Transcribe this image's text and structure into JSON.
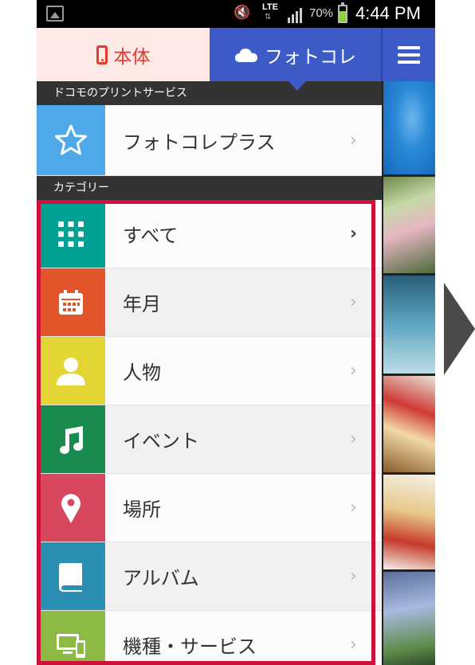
{
  "status_bar": {
    "lte": "LTE",
    "battery_percent": "70%",
    "battery_level": 0.7,
    "time": "4:44 PM"
  },
  "tabs": {
    "device_label": "本体",
    "photocolle_label": "フォトコレ",
    "active": "photocolle",
    "colors": {
      "device_bg": "#fde9e6",
      "device_text": "#e63a2e",
      "photocolle_bg": "#3c5bc6"
    }
  },
  "drawer": {
    "service_header": "ドコモのプリントサービス",
    "service_item": {
      "label": "フォトコレプラス",
      "icon": "star-icon",
      "color": "#4fa8e8"
    },
    "category_header": "カテゴリー",
    "categories": [
      {
        "label": "すべて",
        "icon": "grid-icon",
        "color": "#00a195"
      },
      {
        "label": "年月",
        "icon": "calendar-icon",
        "color": "#e25429"
      },
      {
        "label": "人物",
        "icon": "person-icon",
        "color": "#e2d534"
      },
      {
        "label": "イベント",
        "icon": "music-note-icon",
        "color": "#1a8b4e"
      },
      {
        "label": "場所",
        "icon": "location-pin-icon",
        "color": "#d8475e"
      },
      {
        "label": "アルバム",
        "icon": "album-book-icon",
        "color": "#2b8fb3"
      },
      {
        "label": "機種・サービス",
        "icon": "devices-icon",
        "color": "#8cba44"
      }
    ],
    "chevron": "›",
    "highlight_color": "#d0103c"
  }
}
